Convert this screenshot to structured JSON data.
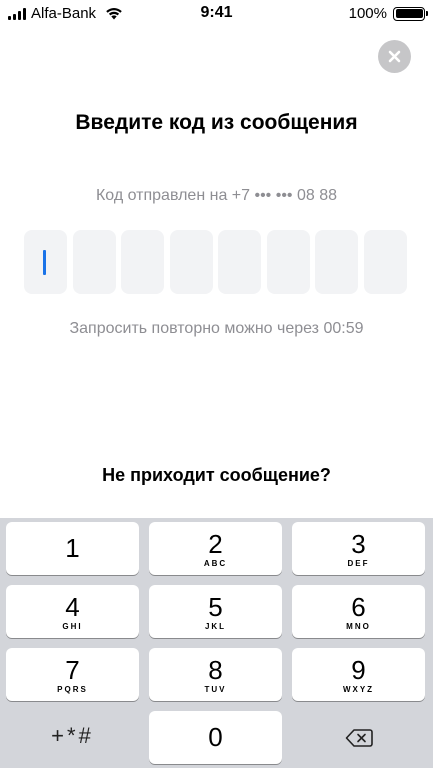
{
  "status_bar": {
    "carrier": "Alfa-Bank",
    "time": "9:41",
    "battery_percent": "100%",
    "battery_level": 1.0
  },
  "close": {
    "icon": "close-icon"
  },
  "title": "Введите код из сообщения",
  "sent_to": "Код отправлен на +7 ••• ••• 08 88",
  "code": {
    "length": 8,
    "filled": []
  },
  "resend_text": "Запросить повторно можно через 00:59",
  "no_message_link": "Не приходит сообщение?",
  "keypad": {
    "keys": [
      {
        "num": "1",
        "letters": ""
      },
      {
        "num": "2",
        "letters": "ABC"
      },
      {
        "num": "3",
        "letters": "DEF"
      },
      {
        "num": "4",
        "letters": "GHI"
      },
      {
        "num": "5",
        "letters": "JKL"
      },
      {
        "num": "6",
        "letters": "MNO"
      },
      {
        "num": "7",
        "letters": "PQRS"
      },
      {
        "num": "8",
        "letters": "TUV"
      },
      {
        "num": "9",
        "letters": "WXYZ"
      },
      {
        "num": "0",
        "letters": ""
      }
    ],
    "symbols_label": "+*#",
    "delete_icon": "backspace-icon"
  },
  "colors": {
    "cursor": "#1a73e8",
    "cell_bg": "#f2f3f5",
    "keypad_bg": "#d3d5da",
    "muted_text": "#8e8e93"
  }
}
